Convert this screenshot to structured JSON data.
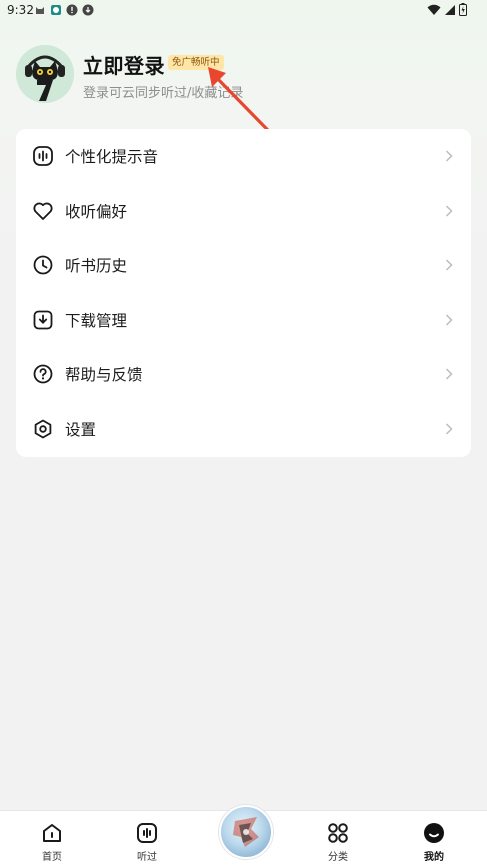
{
  "status_bar": {
    "time": "9:32"
  },
  "profile": {
    "login_title": "立即登录",
    "ad_badge": "免广畅听中",
    "subtitle": "登录可云同步听过/收藏记录"
  },
  "menu": {
    "items": [
      {
        "label": "个性化提示音",
        "icon": "sound-wave-icon"
      },
      {
        "label": "收听偏好",
        "icon": "heart-icon"
      },
      {
        "label": "听书历史",
        "icon": "clock-icon"
      },
      {
        "label": "下载管理",
        "icon": "download-icon"
      },
      {
        "label": "帮助与反馈",
        "icon": "help-icon"
      },
      {
        "label": "设置",
        "icon": "settings-icon"
      }
    ]
  },
  "tabbar": {
    "tabs": [
      {
        "label": "首页",
        "icon": "home-icon"
      },
      {
        "label": "听过",
        "icon": "listened-icon"
      },
      {
        "label": "分类",
        "icon": "category-icon"
      },
      {
        "label": "我的",
        "icon": "profile-icon",
        "active": true
      }
    ]
  },
  "colors": {
    "accent_badge_bg": "#ffe6a6",
    "annotation_arrow": "#e8462f",
    "avatar_bg": "#cfe8d8"
  }
}
